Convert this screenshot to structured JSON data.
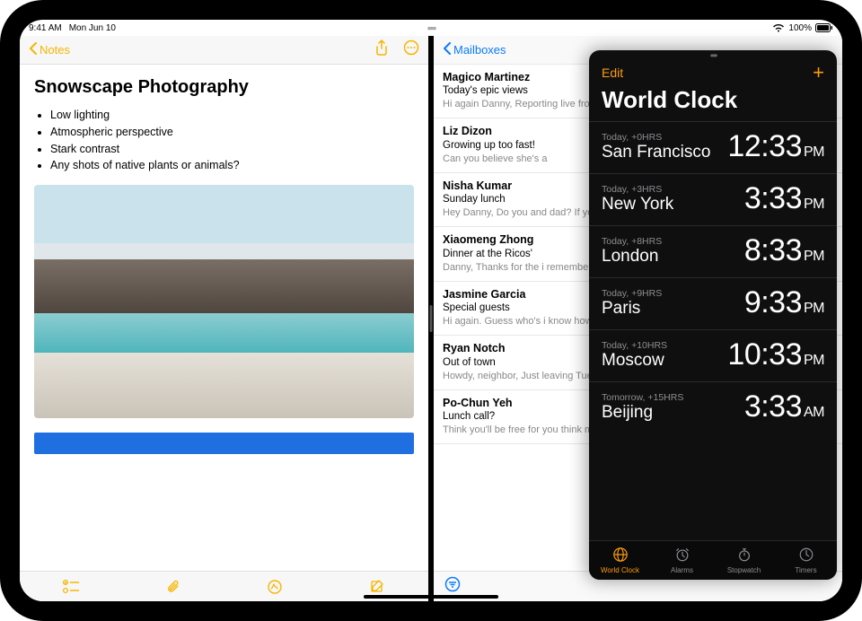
{
  "status": {
    "time": "9:41 AM",
    "date": "Mon Jun 10",
    "battery": "100%"
  },
  "notes": {
    "back_label": "Notes",
    "title": "Snowscape Photography",
    "bullets": [
      "Low lighting",
      "Atmospheric perspective",
      "Stark contrast",
      "Any shots of native plants or animals?"
    ]
  },
  "mail": {
    "back_label": "Mailboxes",
    "items": [
      {
        "from": "Magico Martinez",
        "subject": "Today's epic views",
        "preview": "Hi again Danny, Reporting live from Iceland. Wide open skies, a ger"
      },
      {
        "from": "Liz Dizon",
        "subject": "Growing up too fast!",
        "preview": "Can you believe she's a"
      },
      {
        "from": "Nisha Kumar",
        "subject": "Sunday lunch",
        "preview": "Hey Danny, Do you and dad? If you two join, th"
      },
      {
        "from": "Xiaomeng Zhong",
        "subject": "Dinner at the Ricos'",
        "preview": "Danny, Thanks for the i remembered to take on"
      },
      {
        "from": "Jasmine Garcia",
        "subject": "Special guests",
        "preview": "Hi again. Guess who's i know how to make me"
      },
      {
        "from": "Ryan Notch",
        "subject": "Out of town",
        "preview": "Howdy, neighbor, Just leaving Tuesday and w"
      },
      {
        "from": "Po-Chun Yeh",
        "subject": "Lunch call?",
        "preview": "Think you'll be free for you think might work a"
      }
    ]
  },
  "clock": {
    "edit_label": "Edit",
    "title": "World Clock",
    "rows": [
      {
        "offset": "Today, +0HRS",
        "city": "San Francisco",
        "time": "12:33",
        "ampm": "PM"
      },
      {
        "offset": "Today, +3HRS",
        "city": "New York",
        "time": "3:33",
        "ampm": "PM"
      },
      {
        "offset": "Today, +8HRS",
        "city": "London",
        "time": "8:33",
        "ampm": "PM"
      },
      {
        "offset": "Today, +9HRS",
        "city": "Paris",
        "time": "9:33",
        "ampm": "PM"
      },
      {
        "offset": "Today, +10HRS",
        "city": "Moscow",
        "time": "10:33",
        "ampm": "PM"
      },
      {
        "offset": "Tomorrow, +15HRS",
        "city": "Beijing",
        "time": "3:33",
        "ampm": "AM"
      }
    ],
    "tabs": [
      {
        "label": "World Clock",
        "icon": "globe",
        "active": true
      },
      {
        "label": "Alarms",
        "icon": "alarm",
        "active": false
      },
      {
        "label": "Stopwatch",
        "icon": "stopwatch",
        "active": false
      },
      {
        "label": "Timers",
        "icon": "timer",
        "active": false
      }
    ]
  }
}
